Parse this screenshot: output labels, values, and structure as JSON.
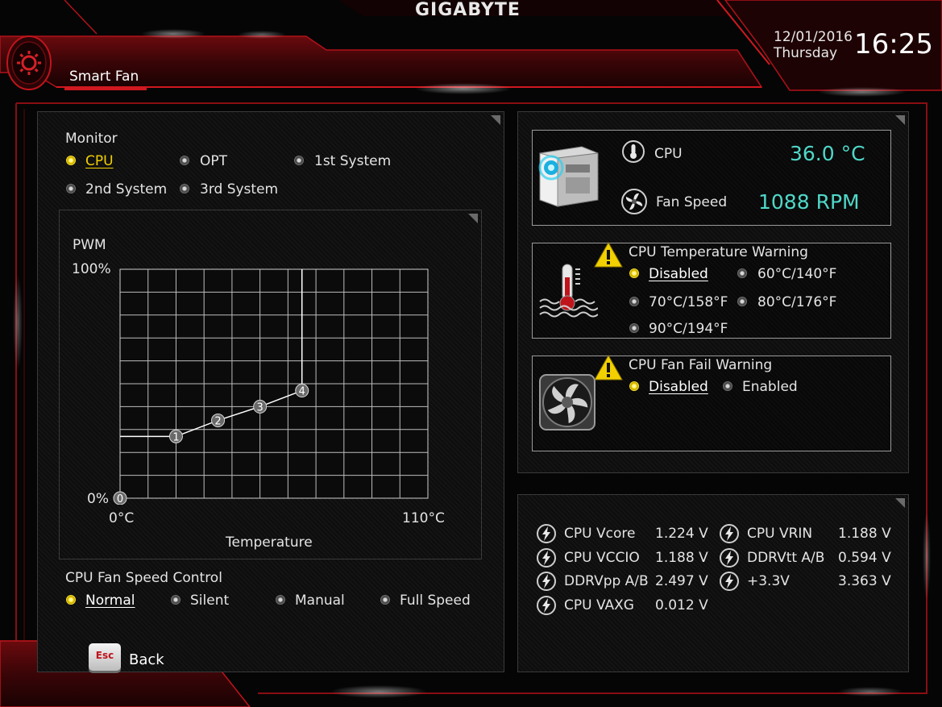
{
  "brand": "GIGABYTE",
  "page_title": "Smart Fan",
  "datetime": {
    "date": "12/01/2016",
    "day": "Thursday",
    "time": "16:25"
  },
  "monitor": {
    "heading": "Monitor",
    "options": [
      {
        "label": "CPU",
        "selected": true
      },
      {
        "label": "OPT",
        "selected": false
      },
      {
        "label": "1st System",
        "selected": false
      },
      {
        "label": "2nd System",
        "selected": false
      },
      {
        "label": "3rd System",
        "selected": false
      }
    ]
  },
  "chart_data": {
    "type": "line",
    "title": "",
    "ylabel": "PWM",
    "xlabel": "Temperature",
    "x_tick_labels": [
      "0°C",
      "110°C"
    ],
    "y_tick_labels": [
      "0%",
      "100%"
    ],
    "xlim": [
      0,
      110
    ],
    "ylim": [
      0,
      100
    ],
    "grid": true,
    "points": [
      {
        "label": "0",
        "x": 0,
        "y": 0
      },
      {
        "label": "1",
        "x": 20,
        "y": 27
      },
      {
        "label": "2",
        "x": 35,
        "y": 34
      },
      {
        "label": "3",
        "x": 50,
        "y": 40
      },
      {
        "label": "4",
        "x": 65,
        "y": 47
      }
    ]
  },
  "fan_control": {
    "heading": "CPU Fan Speed Control",
    "options": [
      {
        "label": "Normal",
        "selected": true
      },
      {
        "label": "Silent",
        "selected": false
      },
      {
        "label": "Manual",
        "selected": false
      },
      {
        "label": "Full Speed",
        "selected": false
      }
    ]
  },
  "back": {
    "key": "Esc",
    "label": "Back"
  },
  "cpu_status": {
    "temp_label": "CPU",
    "temp_value": "36.0 °C",
    "fan_label": "Fan Speed",
    "fan_value": "1088 RPM",
    "value_color": "#4fd8c8"
  },
  "temp_warning": {
    "heading": "CPU Temperature Warning",
    "options": [
      {
        "label": "Disabled",
        "selected": true
      },
      {
        "label": "60°C/140°F",
        "selected": false
      },
      {
        "label": "70°C/158°F",
        "selected": false
      },
      {
        "label": "80°C/176°F",
        "selected": false
      },
      {
        "label": "90°C/194°F",
        "selected": false
      }
    ]
  },
  "fan_fail_warning": {
    "heading": "CPU Fan Fail Warning",
    "options": [
      {
        "label": "Disabled",
        "selected": true
      },
      {
        "label": "Enabled",
        "selected": false
      }
    ]
  },
  "voltages": [
    {
      "label": "CPU Vcore",
      "value": "1.224 V"
    },
    {
      "label": "CPU VRIN",
      "value": "1.188 V"
    },
    {
      "label": "CPU VCCIO",
      "value": "1.188 V"
    },
    {
      "label": "DDRVtt A/B",
      "value": "0.594 V"
    },
    {
      "label": "DDRVpp A/B",
      "value": "2.497 V"
    },
    {
      "label": "+3.3V",
      "value": "3.363 V"
    },
    {
      "label": "CPU VAXG",
      "value": "0.012 V"
    }
  ],
  "colors": {
    "accent_red": "#c0141c",
    "selected_yellow": "#f2d000",
    "readout_cyan": "#4fd8c8"
  }
}
